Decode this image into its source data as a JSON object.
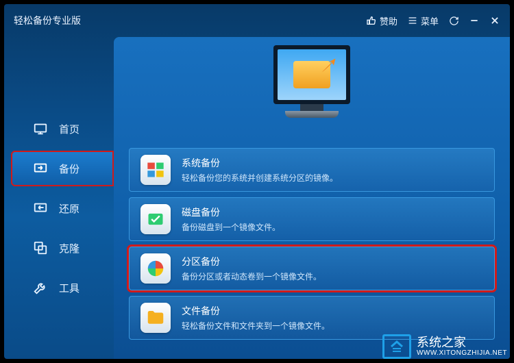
{
  "app": {
    "title": "轻松备份专业版"
  },
  "titlebar": {
    "thumbs_label": "赞助",
    "menu_label": "菜单"
  },
  "sidebar": {
    "items": [
      {
        "id": "home",
        "label": "首页",
        "icon": "home-icon"
      },
      {
        "id": "backup",
        "label": "备份",
        "icon": "backup-icon",
        "active": true,
        "highlight": true
      },
      {
        "id": "restore",
        "label": "还原",
        "icon": "restore-icon"
      },
      {
        "id": "clone",
        "label": "克隆",
        "icon": "clone-icon"
      },
      {
        "id": "tools",
        "label": "工具",
        "icon": "tools-icon"
      }
    ]
  },
  "options": [
    {
      "id": "system",
      "title": "系统备份",
      "desc": "轻松备份您的系统并创建系统分区的镜像。",
      "icon": "windows-icon"
    },
    {
      "id": "disk",
      "title": "磁盘备份",
      "desc": "备份磁盘到一个镜像文件。",
      "icon": "disk-icon"
    },
    {
      "id": "partition",
      "title": "分区备份",
      "desc": "备份分区或者动态卷到一个镜像文件。",
      "icon": "partition-icon",
      "highlight": true
    },
    {
      "id": "file",
      "title": "文件备份",
      "desc": "轻松备份文件和文件夹到一个镜像文件。",
      "icon": "folder-icon"
    }
  ],
  "watermark": {
    "title": "系统之家",
    "url": "WWW.XITONGZHIJIA.NET"
  }
}
